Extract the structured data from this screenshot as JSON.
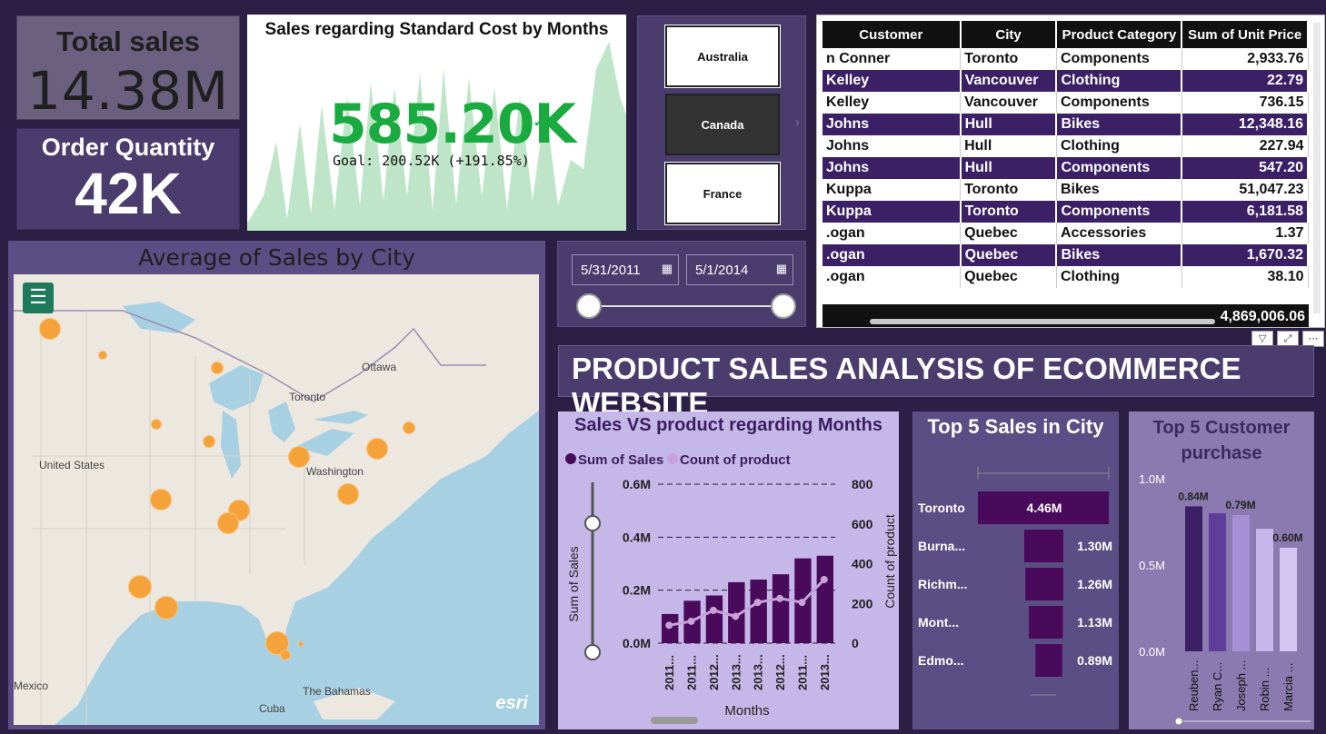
{
  "kpi_total_sales": {
    "title": "Total sales",
    "value": "14.38M"
  },
  "kpi_order_qty": {
    "title": "Order Quantity",
    "value": "42K"
  },
  "goal_card": {
    "title": "Sales regarding Standard Cost by Months",
    "value": "585.20K",
    "goal_text": "Goal: 200.52K (+191.85%)"
  },
  "country_slicer": {
    "items": [
      {
        "label": "Australia",
        "selected": false
      },
      {
        "label": "Canada",
        "selected": true
      },
      {
        "label": "France",
        "selected": false
      }
    ]
  },
  "table": {
    "columns": [
      "Customer",
      "City",
      "Product Category",
      "Sum of Unit Price"
    ],
    "rows": [
      [
        "n Conner",
        "Toronto",
        "Components",
        "2,933.76"
      ],
      [
        "Kelley",
        "Vancouver",
        "Clothing",
        "22.79"
      ],
      [
        "Kelley",
        "Vancouver",
        "Components",
        "736.15"
      ],
      [
        "Johns",
        "Hull",
        "Bikes",
        "12,348.16"
      ],
      [
        "Johns",
        "Hull",
        "Clothing",
        "227.94"
      ],
      [
        "Johns",
        "Hull",
        "Components",
        "547.20"
      ],
      [
        "Kuppa",
        "Toronto",
        "Bikes",
        "51,047.23"
      ],
      [
        "Kuppa",
        "Toronto",
        "Components",
        "6,181.58"
      ],
      [
        ".ogan",
        "Quebec",
        "Accessories",
        "1.37"
      ],
      [
        ".ogan",
        "Quebec",
        "Bikes",
        "1,670.32"
      ],
      [
        ".ogan",
        "Quebec",
        "Clothing",
        "38.10"
      ]
    ],
    "total": "4,869,006.06"
  },
  "map": {
    "title": "Average of Sales by City",
    "labels": [
      "Ottawa",
      "Toronto",
      "United States",
      "Washington",
      "Mexico",
      "The Bahamas",
      "Cuba"
    ],
    "attribution": "esri"
  },
  "date_slicer": {
    "start": "5/31/2011",
    "end": "5/1/2014"
  },
  "banner": {
    "title": "PRODUCT SALES ANALYSIS OF ECOMMERCE WEBSITE"
  },
  "chart_data": [
    {
      "type": "bar",
      "title": "Sales VS product regarding Months",
      "xlabel": "Months",
      "ylabel": "Sum of Sales",
      "y2label": "Count of product",
      "categories": [
        "2011...",
        "2011...",
        "2012...",
        "2013...",
        "2013...",
        "2012...",
        "2011...",
        "2013..."
      ],
      "series": [
        {
          "name": "Sum of Sales",
          "kind": "bar",
          "values": [
            0.11,
            0.16,
            0.18,
            0.23,
            0.24,
            0.26,
            0.32,
            0.33
          ]
        },
        {
          "name": "Count of product",
          "kind": "line",
          "values": [
            90,
            110,
            165,
            135,
            205,
            225,
            205,
            320
          ]
        }
      ],
      "ylim": [
        0,
        0.6
      ],
      "y_ticks": [
        "0.0M",
        "0.2M",
        "0.4M",
        "0.6M"
      ],
      "y2lim": [
        0,
        800
      ],
      "y2_ticks": [
        "0",
        "200",
        "400",
        "600",
        "800"
      ],
      "colors": {
        "bar": "#4a0a5c",
        "line": "#c8a2d6"
      }
    },
    {
      "type": "bar",
      "title": "Top 5 Sales in City",
      "orientation": "horizontal",
      "categories": [
        "Toronto",
        "Burna...",
        "Richm...",
        "Mont...",
        "Edmo..."
      ],
      "values": [
        4.46,
        1.3,
        1.26,
        1.13,
        0.89
      ],
      "labels": [
        "4.46M",
        "1.30M",
        "1.26M",
        "1.13M",
        "0.89M"
      ],
      "colors": {
        "bar": "#4a0a5c"
      }
    },
    {
      "type": "bar",
      "title": "Top 5 Customer purchase",
      "categories": [
        "Reuben...",
        "Ryan C...",
        "Joseph ...",
        "Robin ...",
        "Marcia ..."
      ],
      "values": [
        0.84,
        0.8,
        0.79,
        0.71,
        0.6
      ],
      "labels": [
        "0.84M",
        "",
        "0.79M",
        "",
        "0.60M"
      ],
      "ylim": [
        0,
        1.0
      ],
      "y_ticks": [
        "0.0M",
        "0.5M",
        "1.0M"
      ],
      "colors": {
        "bars": [
          "#3b2065",
          "#5e3e9a",
          "#a78fd6",
          "#c6b6ea",
          "#d4c6f0"
        ]
      }
    }
  ]
}
